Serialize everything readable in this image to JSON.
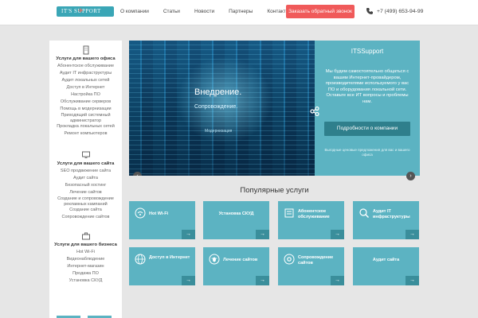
{
  "header": {
    "logo_text": "IT'S   SUPPORT",
    "nav": [
      "О компании",
      "Статьи",
      "Новости",
      "Партнеры",
      "Контакты"
    ],
    "callback": "Заказать обратный звонок",
    "phone": "+7 (499) 653-94-99"
  },
  "sidebar": {
    "office": {
      "title": "Услуги для вашего офиса",
      "items": [
        "Абонентское обслуживание",
        "Аудит IT инфраструктуры",
        "Аудит локальных сетей",
        "Доступ в Интернет",
        "Настройка ПО",
        "Обслуживание серверов",
        "Помощь в модернизации",
        "Приходящий системный администратор",
        "Прокладка локальных сетей",
        "Ремонт компьютеров"
      ]
    },
    "site": {
      "title": "Услуги для вашего сайта",
      "items": [
        "SEO продвижение сайта",
        "Аудит сайта",
        "Безопасный хостинг",
        "Лечение сайтов",
        "Создание и сопровождение рекламных кампаний",
        "Создание сайта",
        "Сопровождение сайтов"
      ]
    },
    "business": {
      "title": "Услуги для вашего бизнеса",
      "items": [
        "Hot Wi-Fi",
        "Видеонаблюдение",
        "Интернет-магазин",
        "Продажа ПО",
        "Установка СКУД"
      ]
    }
  },
  "slider": {
    "heading": "Внедрение.",
    "subheading": "Сопровождение.",
    "small": "Модернизация",
    "prev": "‹",
    "next": "›"
  },
  "panel": {
    "title": "ITSSupport",
    "text": "Мы будем самостоятельно общаться с вашим Интернет-провайдером, производителями используемого у вас ПО и оборудования локальной сети. Оставьте все ИТ вопросы и проблемы нам.",
    "button": "Подробности о компании",
    "footnote": "Выгодные ценовые предложения для вас и вашего офиса"
  },
  "popular": {
    "title": "Популярные услуги",
    "tiles": [
      {
        "label": "Hot Wi-Fi",
        "icon": "wifi-icon"
      },
      {
        "label": "Установка СКУД",
        "icon": ""
      },
      {
        "label": "Абонентское обслуживание",
        "icon": "service-icon"
      },
      {
        "label": "Аудит IT инфраструктуры",
        "icon": "audit-icon"
      },
      {
        "label": "Доступ в Интернет",
        "icon": "globe-icon"
      },
      {
        "label": "Лечение сайтов",
        "icon": "bug-icon"
      },
      {
        "label": "Сопровождение сайтов",
        "icon": "gear-icon"
      },
      {
        "label": "Аудит сайта",
        "icon": ""
      }
    ],
    "arrow": "→"
  },
  "colors": {
    "accent": "#5cb3c2",
    "accent_dark": "#3a8e9b",
    "callback": "#f05a5a"
  }
}
